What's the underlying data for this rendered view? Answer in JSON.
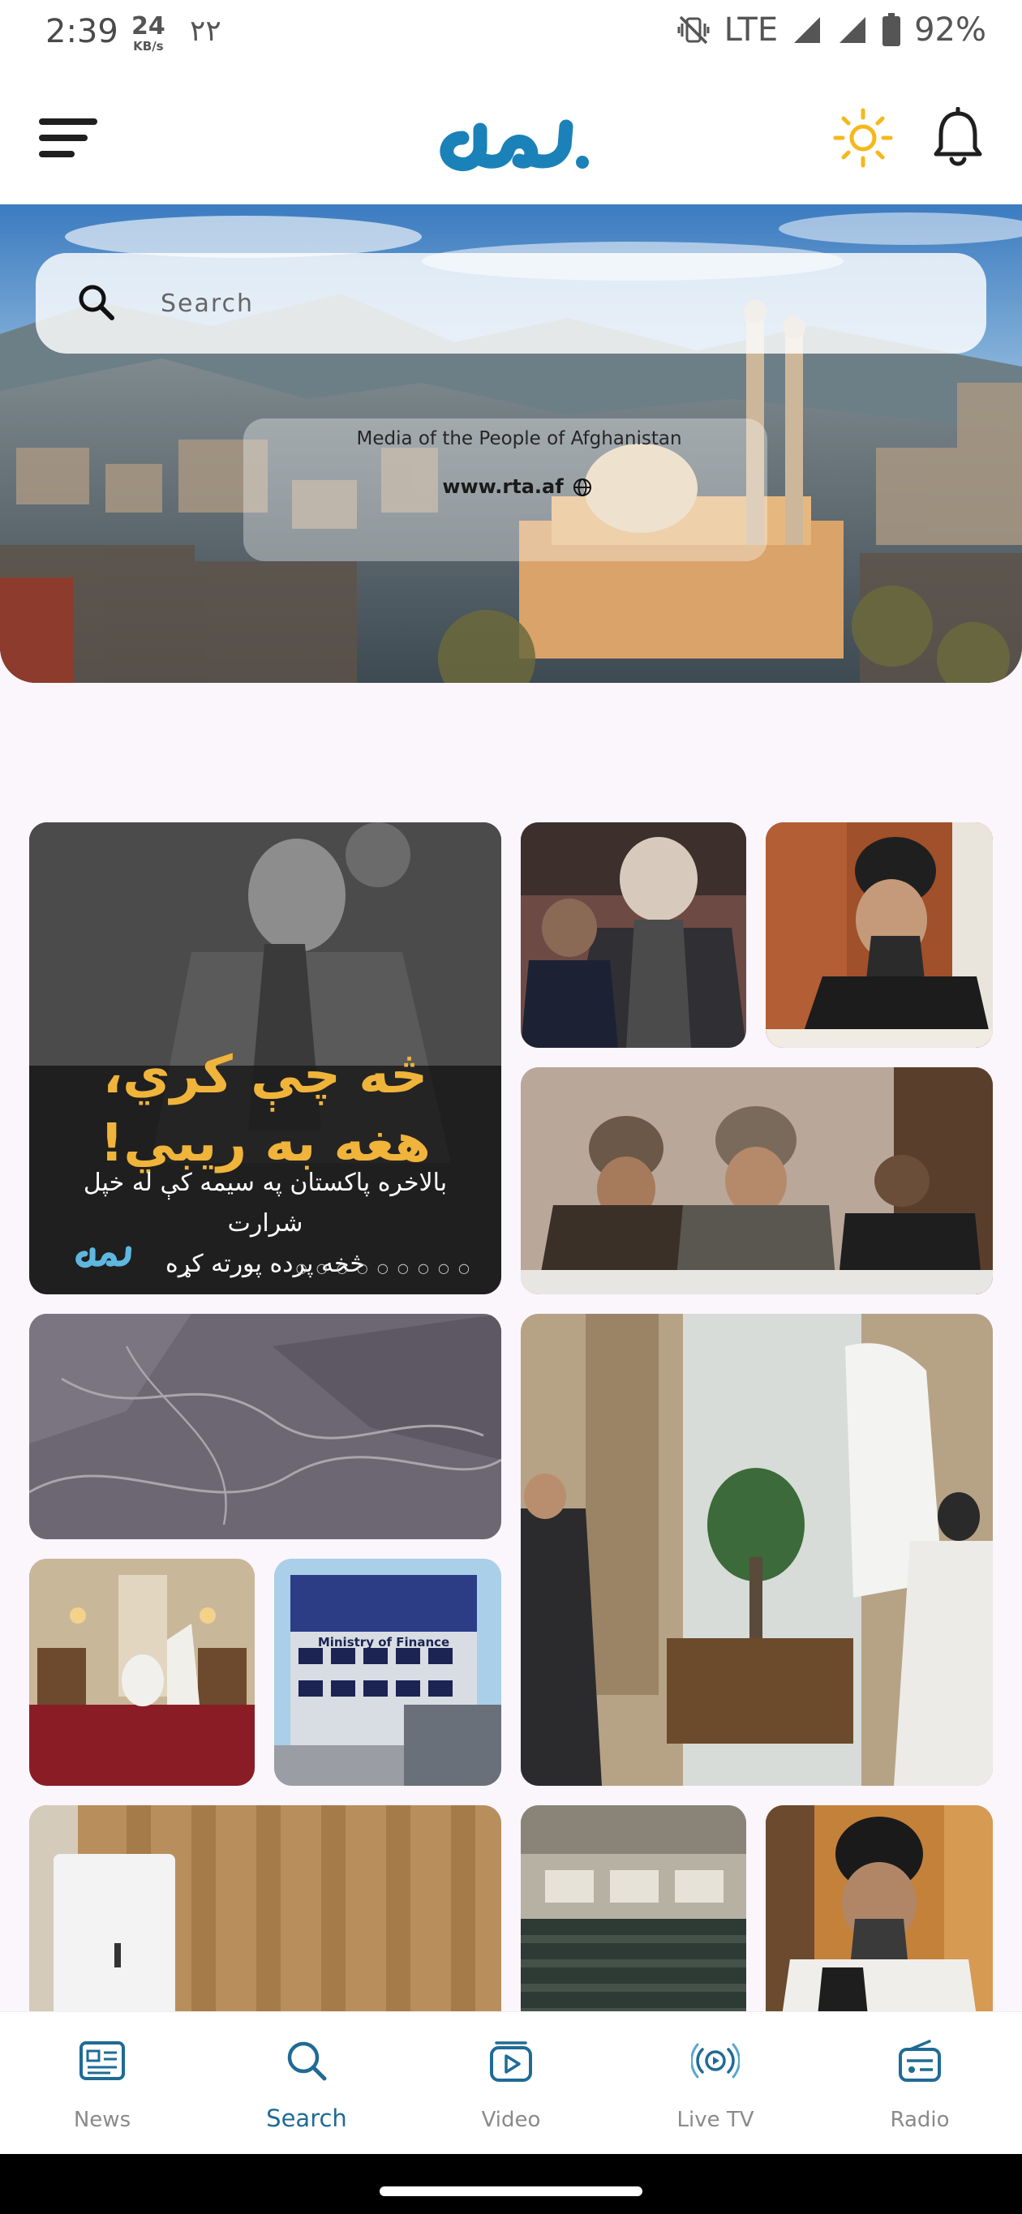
{
  "status_bar": {
    "time": "2:39",
    "speed_value": "24",
    "speed_unit": "KB/s",
    "extra": "٢٢",
    "network": "LTE",
    "battery": "92%"
  },
  "header": {
    "logo_text": "ملی",
    "accent_color": "#1a82b8",
    "sun_color": "#f5b81c"
  },
  "hero": {
    "search_placeholder": "Search",
    "tagline": "Media of  the People of Afghanistan",
    "url": "www.rta.af"
  },
  "grid": {
    "featured": {
      "headline_line1": "څه چې کري،",
      "headline_line2": "هغه به ريبي!",
      "sub_line1": "بالاخره پاکستان په سيمه کې له خپل شرارت",
      "sub_line2": "څخه پرده پورته کړه",
      "logo_text": "ملی"
    },
    "tiles": [
      {
        "name": "tile-parliament-session"
      },
      {
        "name": "tile-official-meeting"
      },
      {
        "name": "tile-press-conference"
      },
      {
        "name": "tile-aerial-terrain"
      },
      {
        "name": "tile-flag-meeting-room"
      },
      {
        "name": "tile-palace-hall"
      },
      {
        "name": "tile-ministry-building"
      },
      {
        "name": "tile-curtain-room"
      },
      {
        "name": "tile-assembly-hall"
      },
      {
        "name": "tile-official-portrait"
      }
    ],
    "ministry_sign": "Ministry of Finance"
  },
  "bottom_nav": {
    "items": [
      {
        "label": "News",
        "icon": "newspaper-icon"
      },
      {
        "label": "Search",
        "icon": "search-icon"
      },
      {
        "label": "Video",
        "icon": "video-icon"
      },
      {
        "label": "Live TV",
        "icon": "live-broadcast-icon"
      },
      {
        "label": "Radio",
        "icon": "radio-icon"
      }
    ],
    "active": "Search",
    "active_color": "#1f6b96",
    "inactive_color": "#8a8a8a"
  }
}
